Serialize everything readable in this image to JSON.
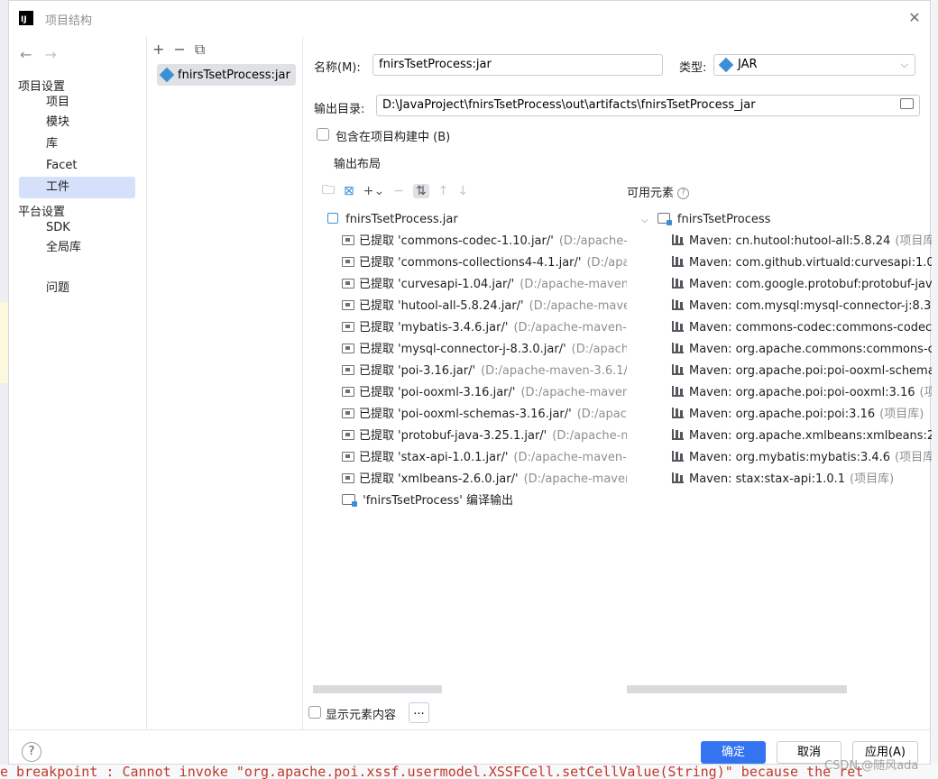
{
  "window": {
    "title": "项目结构",
    "logo_text": "IJ"
  },
  "nav": {
    "project_settings_heading": "项目设置",
    "project_items": [
      "项目",
      "模块",
      "库",
      "Facet",
      "工件"
    ],
    "selected_item": "工件",
    "platform_heading": "平台设置",
    "platform_items": [
      "SDK",
      "全局库"
    ],
    "problems": "问题"
  },
  "artifacts": {
    "list": [
      "fnirsTsetProcess:jar"
    ]
  },
  "form": {
    "name_label": "名称(M):",
    "name_value": "fnirsTsetProcess:jar",
    "type_label": "类型:",
    "type_value": "JAR",
    "output_dir_label": "输出目录:",
    "output_dir_value": "D:\\JavaProject\\fnirsTsetProcess\\out\\artifacts\\fnirsTsetProcess_jar",
    "include_in_build_label": "包含在项目构建中 (B)",
    "include_in_build_checked": false,
    "output_layout_tab": "输出布局",
    "available_elements_label": "可用元素"
  },
  "layout_tree": {
    "root": "fnirsTsetProcess.jar",
    "extracted_prefix": "已提取",
    "extracted": [
      {
        "name": "'commons-codec-1.10.jar/'",
        "path": "(D:/apache-m"
      },
      {
        "name": "'commons-collections4-4.1.jar/'",
        "path": "(D:/apac"
      },
      {
        "name": "'curvesapi-1.04.jar/'",
        "path": "(D:/apache-maven-3"
      },
      {
        "name": "'hutool-all-5.8.24.jar/'",
        "path": "(D:/apache-maven"
      },
      {
        "name": "'mybatis-3.4.6.jar/'",
        "path": "(D:/apache-maven-3."
      },
      {
        "name": "'mysql-connector-j-8.3.0.jar/'",
        "path": "(D:/apache"
      },
      {
        "name": "'poi-3.16.jar/'",
        "path": "(D:/apache-maven-3.6.1/m"
      },
      {
        "name": "'poi-ooxml-3.16.jar/'",
        "path": "(D:/apache-maven-3"
      },
      {
        "name": "'poi-ooxml-schemas-3.16.jar/'",
        "path": "(D:/apache"
      },
      {
        "name": "'protobuf-java-3.25.1.jar/'",
        "path": "(D:/apache-ma"
      },
      {
        "name": "'stax-api-1.0.1.jar/'",
        "path": "(D:/apache-maven-3."
      },
      {
        "name": "'xmlbeans-2.6.0.jar/'",
        "path": "(D:/apache-maven-"
      }
    ],
    "compile_output": "'fnirsTsetProcess' 编译输出"
  },
  "available_tree": {
    "root": "fnirsTsetProcess",
    "items": [
      {
        "name": "Maven: cn.hutool:hutool-all:5.8.24",
        "suffix": "(项目库)"
      },
      {
        "name": "Maven: com.github.virtuald:curvesapi:1.04",
        "suffix": "("
      },
      {
        "name": "Maven: com.google.protobuf:protobuf-java:",
        "suffix": ""
      },
      {
        "name": "Maven: com.mysql:mysql-connector-j:8.3.0",
        "suffix": ""
      },
      {
        "name": "Maven: commons-codec:commons-codec:1.",
        "suffix": ""
      },
      {
        "name": "Maven: org.apache.commons:commons-coll",
        "suffix": ""
      },
      {
        "name": "Maven: org.apache.poi:poi-ooxml-schemas:",
        "suffix": ""
      },
      {
        "name": "Maven: org.apache.poi:poi-ooxml:3.16",
        "suffix": "(项目"
      },
      {
        "name": "Maven: org.apache.poi:poi:3.16",
        "suffix": "(项目库)"
      },
      {
        "name": "Maven: org.apache.xmlbeans:xmlbeans:2.6.0",
        "suffix": ""
      },
      {
        "name": "Maven: org.mybatis:mybatis:3.4.6",
        "suffix": "(项目库)"
      },
      {
        "name": "Maven: stax:stax-api:1.0.1",
        "suffix": "(项目库)"
      }
    ]
  },
  "bottom": {
    "show_content_label": "显示元素内容",
    "show_content_checked": false,
    "more_label": "..."
  },
  "footer": {
    "help": "?",
    "ok": "确定",
    "cancel": "取消",
    "apply": "应用(A)"
  },
  "background": {
    "console_text": "e breakpoint : Cannot invoke \"org.apache.poi.xssf.usermodel.XSSFCell.setCellValue(String)\" because the ret"
  },
  "watermark": "CSDN @随风ada",
  "colors": {
    "accent": "#3574f0",
    "selection": "#d5e1fb",
    "jar_icon": "#3b8fd6",
    "error_text": "#c0392b"
  }
}
